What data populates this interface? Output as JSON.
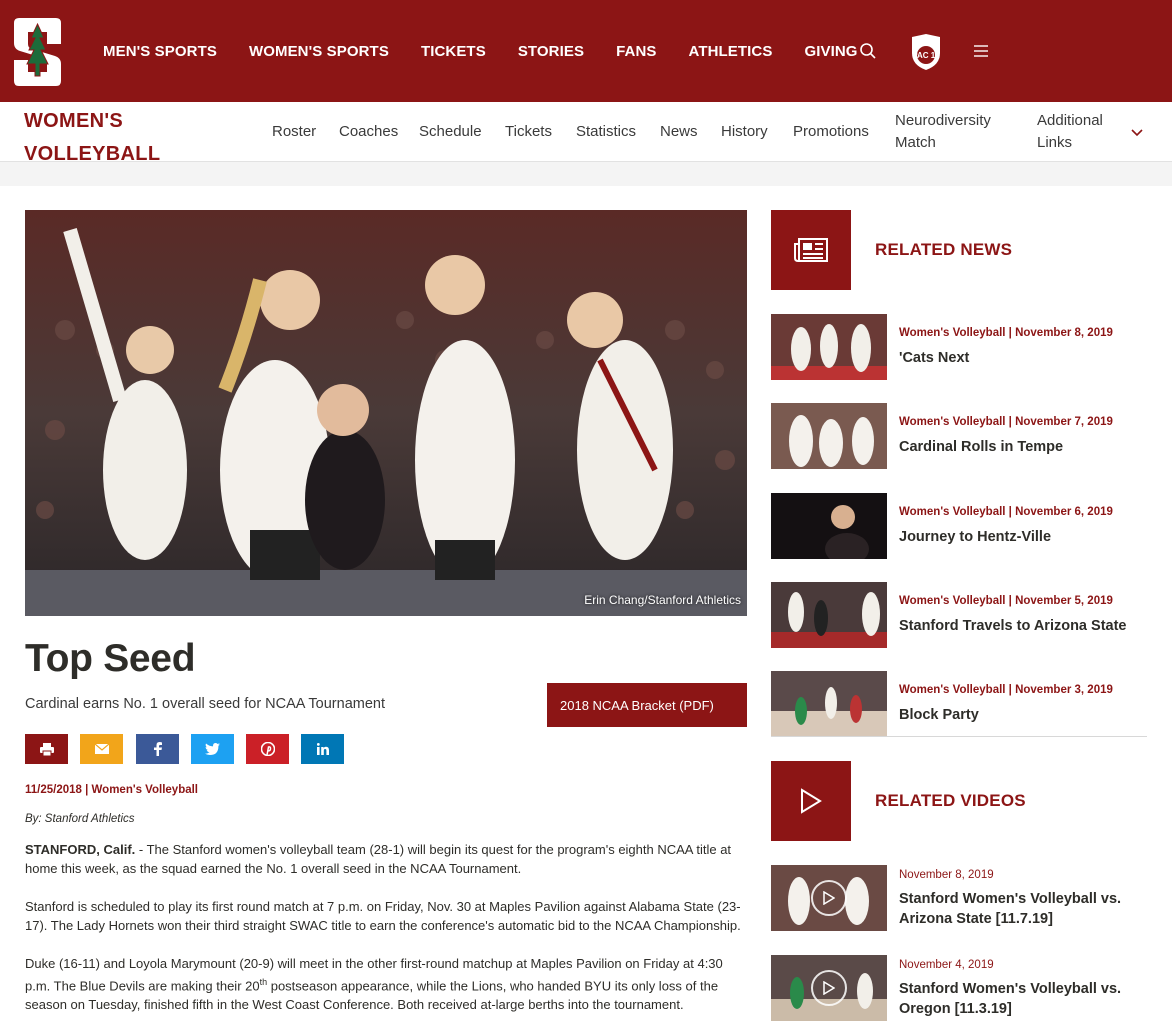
{
  "colors": {
    "brand": "#8c1515",
    "text": "#2e2d29",
    "facebook": "#3b5998",
    "twitter": "#1da1f2",
    "pinterest": "#cb2027",
    "linkedin": "#0077b5",
    "email": "#f2a51a"
  },
  "top_nav": {
    "items": [
      "MEN'S SPORTS",
      "WOMEN'S SPORTS",
      "TICKETS",
      "STORIES",
      "FANS",
      "ATHLETICS",
      "GIVING"
    ],
    "icons": [
      "search-icon",
      "pac12-logo",
      "menu-icon"
    ],
    "pac12_text": "PAC 12"
  },
  "sub_nav": {
    "sport_line1": "WOMEN'S",
    "sport_line2": "VOLLEYBALL",
    "links": [
      "Roster",
      "Coaches",
      "Schedule",
      "Tickets",
      "Statistics",
      "News",
      "History",
      "Promotions"
    ],
    "neuro_line1": "Neurodiversity",
    "neuro_line2": "Match",
    "additional_line1": "Additional",
    "additional_line2": "Links"
  },
  "article": {
    "photo_credit": "Erin Chang/Stanford Athletics",
    "title": "Top Seed",
    "subtitle": "Cardinal earns No. 1 overall seed for NCAA Tournament",
    "pdf_button": "2018 NCAA Bracket (PDF)",
    "share_icons": [
      "print-icon",
      "email-icon",
      "facebook-icon",
      "twitter-icon",
      "pinterest-icon",
      "linkedin-icon"
    ],
    "meta": "11/25/2018 | Women's Volleyball",
    "byline": "By: Stanford Athletics",
    "p1_lead": "STANFORD, Calif.",
    "p1_line1": " - The Stanford women's volleyball team (28-1) will begin its quest for the program's eighth NCAA title at",
    "p1_line2": "home this week, as the squad earned the No. 1 overall seed in the NCAA Tournament.",
    "p2_line1": "Stanford is scheduled to play its first round match at 7 p.m. on Friday, Nov. 30 at Maples Pavilion against Alabama State (23-",
    "p2_line2": "17). The Lady Hornets won their third straight SWAC title to earn the conference's automatic bid to the NCAA Championship.",
    "p3_line1": "Duke (16-11) and Loyola Marymount (20-9) will meet in the other first-round matchup at Maples Pavilion on Friday at 4:30",
    "p3_line2a": "p.m. The Blue Devils are making their 20",
    "p3_sup": "th",
    "p3_line2b": " postseason appearance, while the Lions, who handed BYU its only loss of the",
    "p3_line3": "season on Tuesday, finished fifth in the West Coast Conference. Both received at-large berths into the tournament."
  },
  "related_news": {
    "title": "RELATED NEWS",
    "items": [
      {
        "meta": "Women's Volleyball | November 8, 2019",
        "title": "'Cats Next"
      },
      {
        "meta": "Women's Volleyball | November 7, 2019",
        "title": "Cardinal Rolls in Tempe"
      },
      {
        "meta": "Women's Volleyball | November 6, 2019",
        "title": "Journey to Hentz-Ville"
      },
      {
        "meta": "Women's Volleyball | November 5, 2019",
        "title": "Stanford Travels to Arizona State"
      },
      {
        "meta": "Women's Volleyball | November 3, 2019",
        "title": "Block Party"
      }
    ]
  },
  "related_videos": {
    "title": "RELATED VIDEOS",
    "items": [
      {
        "date": "November 8, 2019",
        "title": "Stanford Women's Volleyball vs. Arizona State [11.7.19]"
      },
      {
        "date": "November 4, 2019",
        "title": "Stanford Women's Volleyball vs. Oregon [11.3.19]"
      }
    ]
  }
}
